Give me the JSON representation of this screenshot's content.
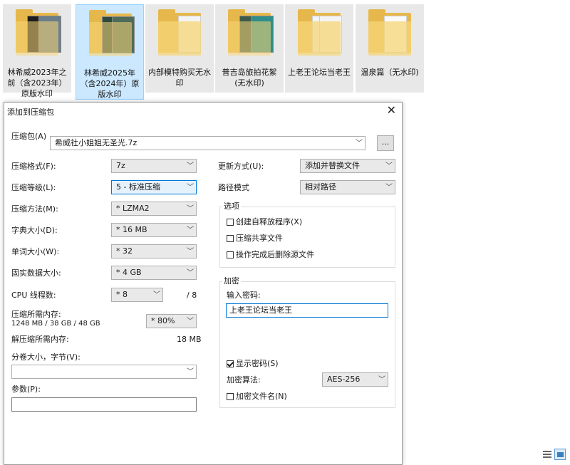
{
  "tiles": [
    {
      "name": "林希威2023年之前（含2023年）原版水印"
    },
    {
      "name": "林希威2025年（含2024年）原版水印"
    },
    {
      "name": "内部模特购买无水印"
    },
    {
      "name": "普吉岛旅拍花絮(无水印)"
    },
    {
      "name": "上老王论坛当老王"
    },
    {
      "name": "温泉篇（无水印)"
    }
  ],
  "dialog": {
    "title": "添加到压缩包",
    "archive_label": "压缩包(A)",
    "archive_value": "希威社小姐姐无圣光.7z",
    "browse_label": "...",
    "format_label": "压缩格式(F):",
    "format_value": "7z",
    "level_label": "压缩等级(L):",
    "level_value": "5 - 标准压缩",
    "method_label": "压缩方法(M):",
    "method_value": "* LZMA2",
    "dict_label": "字典大小(D):",
    "dict_value": "* 16 MB",
    "word_label": "单词大小(W):",
    "word_value": "* 32",
    "solid_label": "固实数据大小:",
    "solid_value": "* 4 GB",
    "cpu_label": "CPU 线程数:",
    "cpu_value": "* 8",
    "cpu_total": "/ 8",
    "mem_comp_label": "压缩所需内存:",
    "mem_comp_detail": "1248 MB / 38 GB / 48 GB",
    "mem_percent": "* 80%",
    "mem_decomp_label": "解压缩所需内存:",
    "mem_decomp_value": "18 MB",
    "split_label": "分卷大小，字节(V):",
    "split_value": "",
    "params_label": "参数(P):",
    "params_value": "",
    "update_label": "更新方式(U):",
    "update_value": "添加并替换文件",
    "path_label": "路径模式",
    "path_value": "相对路径",
    "options_title": "选项",
    "opt_sfx": "创建自释放程序(X)",
    "opt_shared": "压缩共享文件",
    "opt_delete": "操作完成后删除源文件",
    "enc_title": "加密",
    "password_label": "输入密码:",
    "password_value": "上老王论坛当老王",
    "show_password": "显示密码(S)",
    "enc_method_label": "加密算法:",
    "enc_method_value": "AES-256",
    "enc_filenames": "加密文件名(N)"
  }
}
